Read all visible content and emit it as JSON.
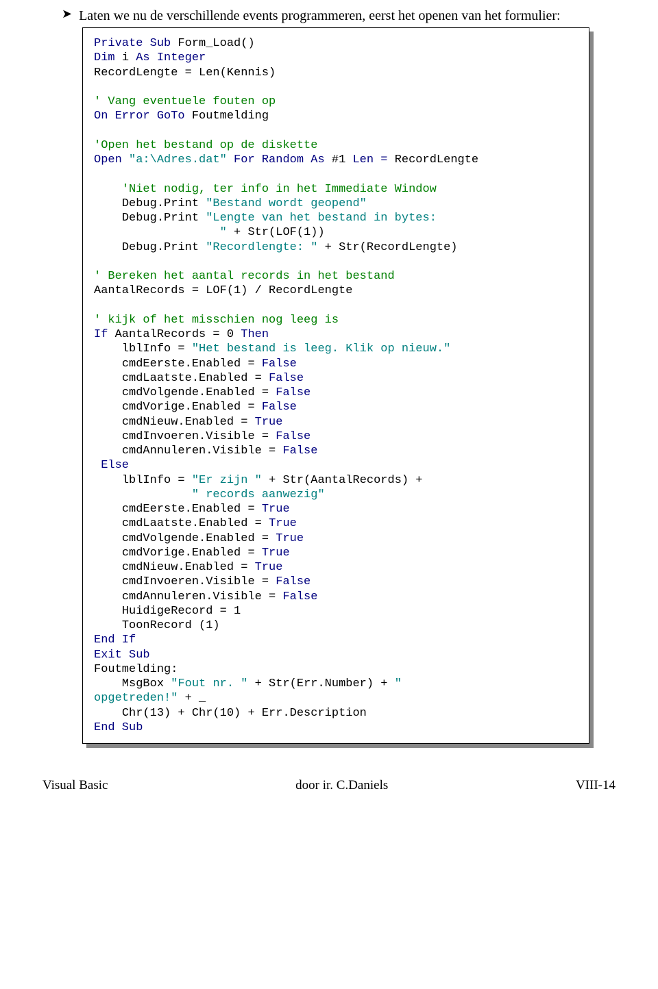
{
  "intro": "Laten we nu de verschillende events programmeren, eerst het openen van het formulier:",
  "code": {
    "l01a": "Private Sub ",
    "l01b": "Form_Load()",
    "l02a": "Dim ",
    "l02b": "i ",
    "l02c": "As Integer",
    "l03": "RecordLengte = Len(Kennis)",
    "l04": "",
    "l05": "' Vang eventuele fouten op",
    "l06a": "On Error GoTo ",
    "l06b": "Foutmelding",
    "l07": "",
    "l08": "'Open het bestand op de diskette",
    "l09a": "Open ",
    "l09b": "\"a:\\Adres.dat\" ",
    "l09c": "For Random As ",
    "l09d": "#1 ",
    "l09e": "Len = ",
    "l09f": "RecordLengte",
    "l10": "",
    "l11": "    'Niet nodig, ter info in het Immediate Window",
    "l12a": "    Debug.Print ",
    "l12b": "\"Bestand wordt geopend\"",
    "l13a": "    Debug.Print ",
    "l13b": "\"Lengte van het bestand in bytes:",
    "l14a": "                  \"",
    "l14b": " + Str(LOF(1))",
    "l15a": "    Debug.Print ",
    "l15b": "\"Recordlengte: \"",
    "l15c": " + Str(RecordLengte)",
    "l16": "",
    "l17": "' Bereken het aantal records in het bestand",
    "l18": "AantalRecords = LOF(1) / RecordLengte",
    "l19": "",
    "l20": "' kijk of het misschien nog leeg is",
    "l21a": "If ",
    "l21b": "AantalRecords = 0 ",
    "l21c": "Then",
    "l22a": "    lblInfo = ",
    "l22b": "\"Het bestand is leeg. Klik op nieuw.\"",
    "l23a": "    cmdEerste.Enabled = ",
    "l23b": "False",
    "l24a": "    cmdLaatste.Enabled = ",
    "l24b": "False",
    "l25a": "    cmdVolgende.Enabled = ",
    "l25b": "False",
    "l26a": "    cmdVorige.Enabled = ",
    "l26b": "False",
    "l27a": "    cmdNieuw.Enabled = ",
    "l27b": "True",
    "l28a": "    cmdInvoeren.Visible = ",
    "l28b": "False",
    "l29a": "    cmdAnnuleren.Visible = ",
    "l29b": "False",
    "l30": " Else",
    "l31a": "    lblInfo = ",
    "l31b": "\"Er zijn \"",
    "l31c": " + Str(AantalRecords) +",
    "l32": "              \" records aanwezig\"",
    "l33a": "    cmdEerste.Enabled = ",
    "l33b": "True",
    "l34a": "    cmdLaatste.Enabled = ",
    "l34b": "True",
    "l35a": "    cmdVolgende.Enabled = ",
    "l35b": "True",
    "l36a": "    cmdVorige.Enabled = ",
    "l36b": "True",
    "l37a": "    cmdNieuw.Enabled = ",
    "l37b": "True",
    "l38a": "    cmdInvoeren.Visible = ",
    "l38b": "False",
    "l39a": "    cmdAnnuleren.Visible = ",
    "l39b": "False",
    "l40": "    HuidigeRecord = 1",
    "l41": "    ToonRecord (1)",
    "l42": "End If",
    "l43": "Exit Sub",
    "l44": "Foutmelding:",
    "l45a": "    MsgBox ",
    "l45b": "\"Fout nr. \"",
    "l45c": " + Str(Err.Number) + ",
    "l45d": "\"",
    "l46a": "opgetreden!\"",
    "l46b": " + _",
    "l47": "    Chr(13) + Chr(10) + Err.Description",
    "l48": "End Sub"
  },
  "footer": {
    "left": "Visual Basic",
    "center": "door ir. C.Daniels",
    "right": "VIII-14"
  }
}
